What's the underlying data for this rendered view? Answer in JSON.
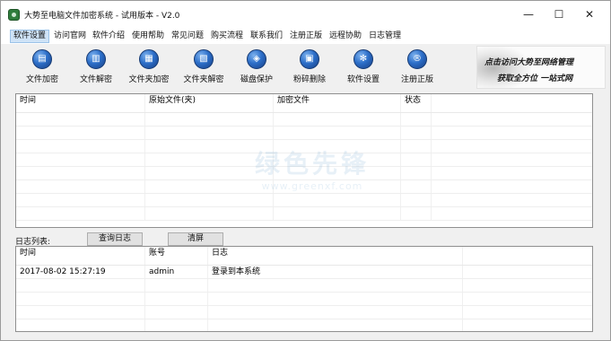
{
  "window": {
    "title": "大势至电脑文件加密系统 - 试用版本 - V2.0",
    "controls": {
      "minimize": "—",
      "maximize": "☐",
      "close": "✕"
    }
  },
  "menu": {
    "items": [
      "软件设置",
      "访问官网",
      "软件介绍",
      "使用帮助",
      "常见问题",
      "购买流程",
      "联系我们",
      "注册正版",
      "远程协助",
      "日志管理"
    ]
  },
  "toolbar": {
    "items": [
      {
        "label": "文件加密",
        "icon": "file-lock-icon",
        "glyph": "▤"
      },
      {
        "label": "文件解密",
        "icon": "file-unlock-icon",
        "glyph": "▥"
      },
      {
        "label": "文件夹加密",
        "icon": "folder-lock-icon",
        "glyph": "▦"
      },
      {
        "label": "文件夹解密",
        "icon": "folder-unlock-icon",
        "glyph": "▧"
      },
      {
        "label": "磁盘保护",
        "icon": "disk-shield-icon",
        "glyph": "◈"
      },
      {
        "label": "粉碎删除",
        "icon": "shredder-icon",
        "glyph": "▣"
      },
      {
        "label": "软件设置",
        "icon": "gear-icon",
        "glyph": "✻"
      },
      {
        "label": "注册正版",
        "icon": "registered-icon",
        "glyph": "®"
      }
    ]
  },
  "banner": {
    "line1": "点击访问大势至网络管理",
    "line2": "获取全方位 一站式网"
  },
  "encrypt_table": {
    "columns": [
      "时间",
      "原始文件(夹)",
      "加密文件",
      "状态"
    ],
    "rows": []
  },
  "log": {
    "label": "日志列表:",
    "query_button": "查询日志",
    "clear_button": "清屏",
    "columns": [
      "时间",
      "账号",
      "日志"
    ],
    "rows": [
      [
        "2017-08-02 15:27:19",
        "admin",
        "登录到本系统"
      ]
    ]
  },
  "watermark": {
    "line1": "绿色先锋",
    "line2": "www.greenxf.com"
  }
}
